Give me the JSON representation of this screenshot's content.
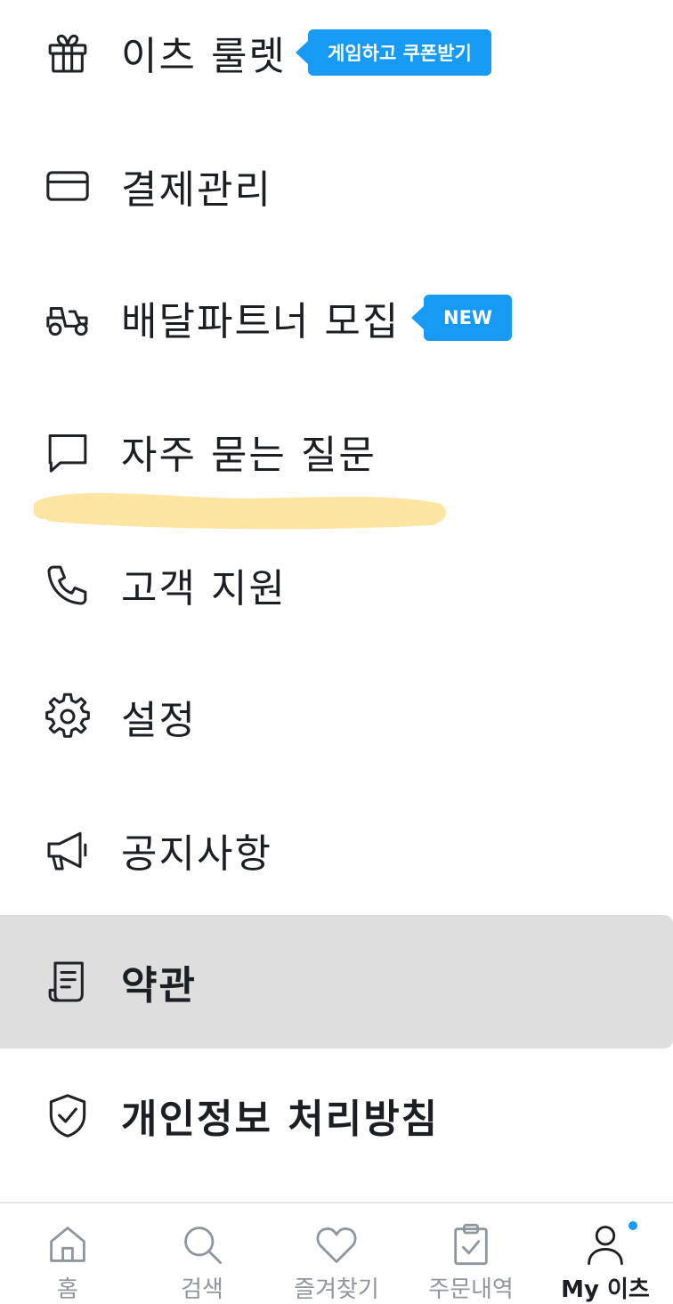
{
  "menu": {
    "items": [
      {
        "label": "이츠 룰렛",
        "icon": "gift-icon",
        "badge": "게임하고 쿠폰받기"
      },
      {
        "label": "결제관리",
        "icon": "credit-card-icon"
      },
      {
        "label": "배달파트너 모집",
        "icon": "scooter-icon",
        "badge": "NEW"
      },
      {
        "label": "자주 묻는 질문",
        "icon": "chat-bubble-icon"
      },
      {
        "label": "고객 지원",
        "icon": "phone-icon"
      },
      {
        "label": "설정",
        "icon": "gear-icon"
      },
      {
        "label": "공지사항",
        "icon": "megaphone-icon"
      },
      {
        "label": "약관",
        "icon": "document-icon"
      },
      {
        "label": "개인정보 처리방침",
        "icon": "shield-check-icon"
      }
    ]
  },
  "bottom_nav": {
    "items": [
      {
        "label": "홈",
        "icon": "home-icon"
      },
      {
        "label": "검색",
        "icon": "search-icon"
      },
      {
        "label": "즐겨찾기",
        "icon": "heart-icon"
      },
      {
        "label": "주문내역",
        "icon": "clipboard-check-icon"
      },
      {
        "label": "My 이츠",
        "icon": "user-icon"
      }
    ]
  },
  "colors": {
    "accent": "#169af3",
    "highlight": "#fde6a3",
    "selected_row_bg": "#dedede",
    "text": "#1b1f24",
    "inactive": "#8f969d"
  }
}
